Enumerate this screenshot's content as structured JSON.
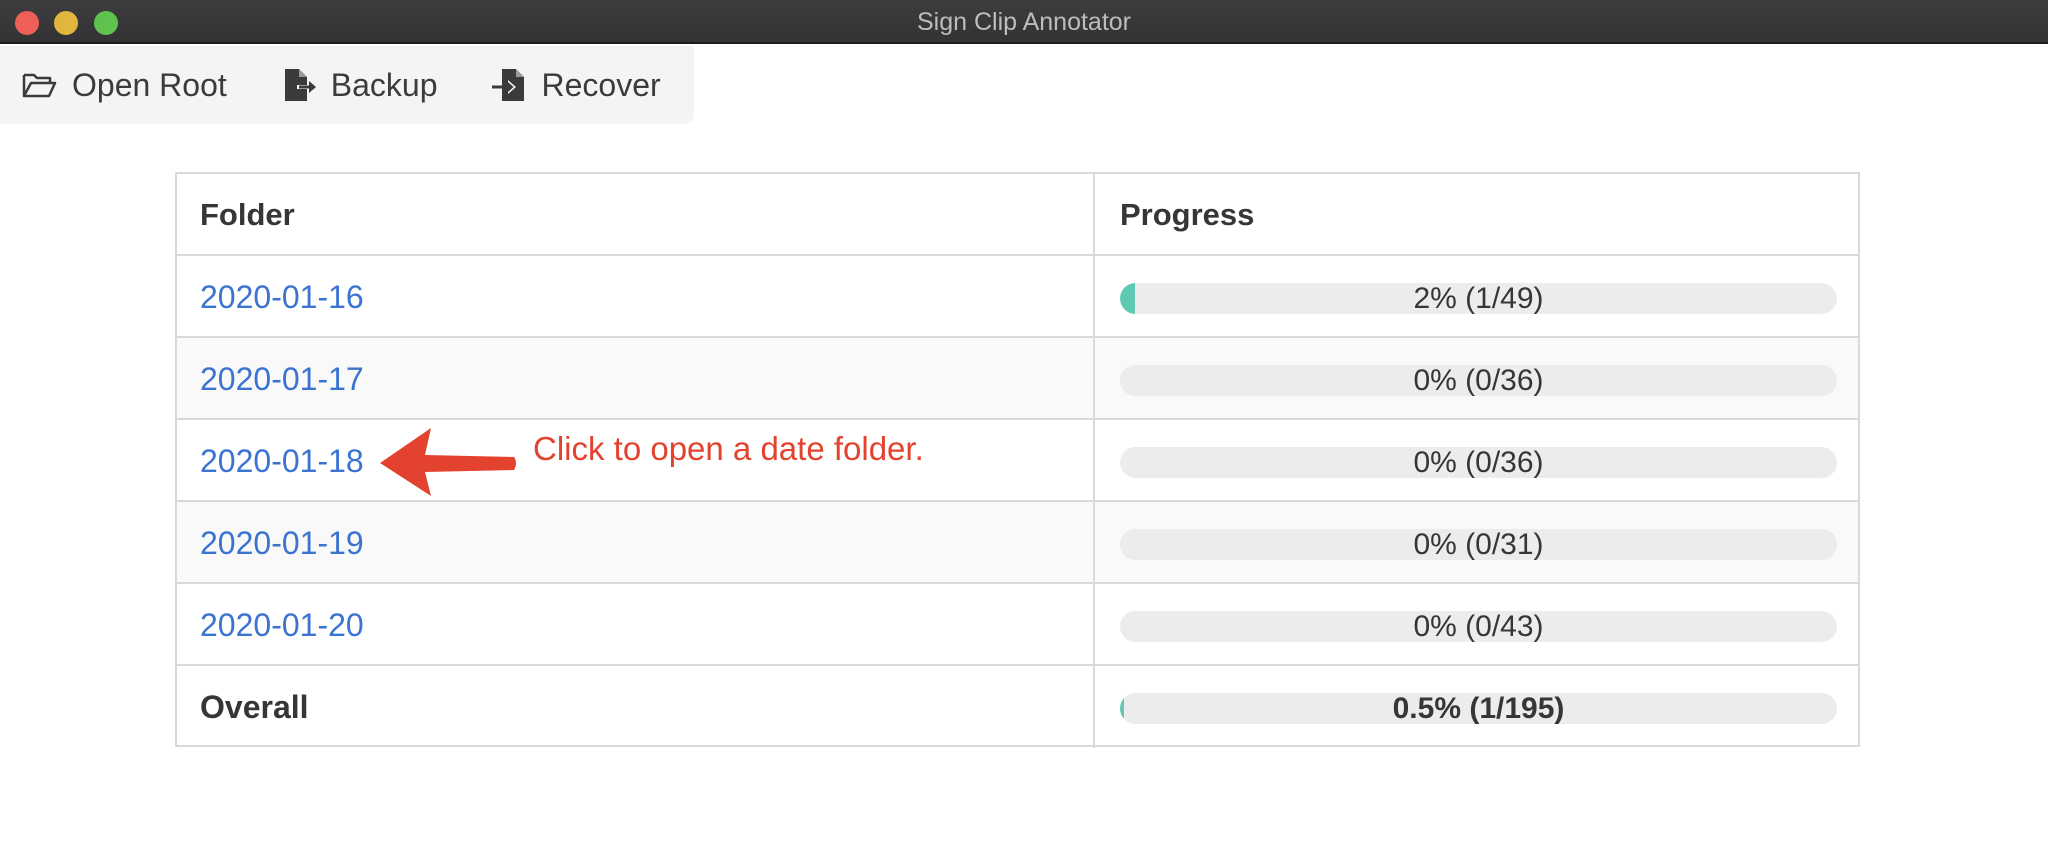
{
  "window": {
    "title": "Sign Clip Annotator"
  },
  "toolbar": {
    "open_root": {
      "label": "Open Root",
      "icon": "folder-open-icon"
    },
    "backup": {
      "label": "Backup",
      "icon": "file-export-icon"
    },
    "recover": {
      "label": "Recover",
      "icon": "file-import-icon"
    }
  },
  "table": {
    "headers": {
      "folder": "Folder",
      "progress": "Progress"
    },
    "rows": [
      {
        "folder": "2020-01-16",
        "progress_label": "2% (1/49)",
        "progress_fraction": 0.0204
      },
      {
        "folder": "2020-01-17",
        "progress_label": "0% (0/36)",
        "progress_fraction": 0
      },
      {
        "folder": "2020-01-18",
        "progress_label": "0% (0/36)",
        "progress_fraction": 0
      },
      {
        "folder": "2020-01-19",
        "progress_label": "0% (0/31)",
        "progress_fraction": 0
      },
      {
        "folder": "2020-01-20",
        "progress_label": "0% (0/43)",
        "progress_fraction": 0
      }
    ],
    "overall": {
      "label": "Overall",
      "progress_label": "0.5% (1/195)",
      "progress_fraction": 0.0051
    }
  },
  "annotation": {
    "text": "Click to open a date folder.",
    "color": "#e3422e"
  },
  "colors": {
    "link": "#3b73d1",
    "progress_fill": "#5fcab4",
    "progress_track": "#ececec"
  }
}
